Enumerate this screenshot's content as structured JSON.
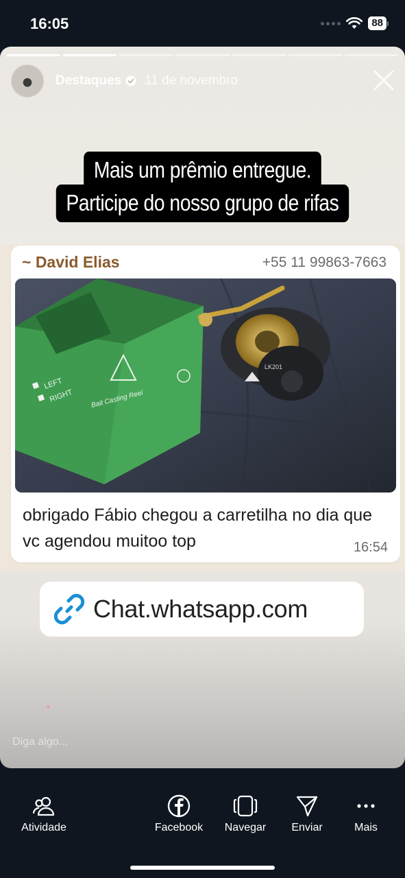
{
  "status_bar": {
    "time": "16:05",
    "battery": "88"
  },
  "story": {
    "progress": {
      "segments_total": 7,
      "segments_done": 2
    },
    "account_name": "Destaques",
    "date": "11 de novembro",
    "caption_lines": [
      "Mais um prêmio entregue.",
      "Participe do nosso grupo de rifas"
    ],
    "chat": {
      "sender": "~ David Elias",
      "phone": "+55 11 99863-7663",
      "message": "obrigado Fábio chegou a carretilha no dia que vc agendou muitoo top",
      "time": "16:54",
      "photo_texts": {
        "box_left": "LEFT",
        "box_right": "RIGHT",
        "box_brand": "Bait Casting Reel",
        "reel_model": "LK201"
      }
    },
    "link": {
      "text": "Chat.whatsapp.com"
    },
    "reply_placeholder": "Diga algo..."
  },
  "bottom_nav": [
    {
      "label": "Atividade",
      "icon": "people-icon"
    },
    {
      "label": "Facebook",
      "icon": "facebook-icon"
    },
    {
      "label": "Navegar",
      "icon": "navigate-icon"
    },
    {
      "label": "Enviar",
      "icon": "send-icon"
    },
    {
      "label": "Mais",
      "icon": "more-icon"
    }
  ],
  "colors": {
    "background": "#0f161f",
    "sender": "#8a5a2e",
    "link_icon": "#1a8fd6",
    "box_green": "#3e9a4e"
  }
}
